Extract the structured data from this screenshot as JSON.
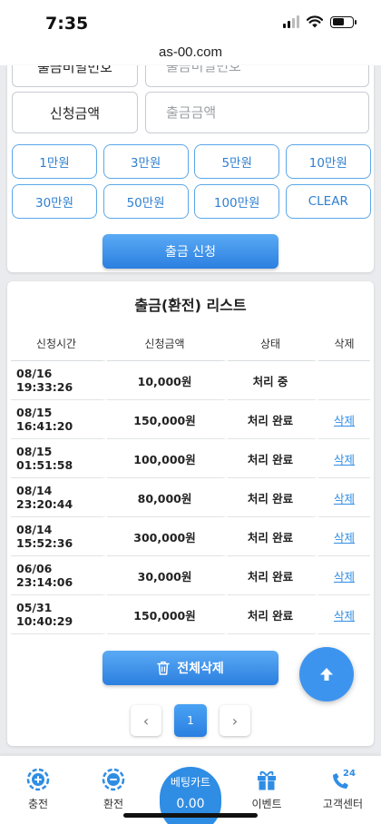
{
  "status": {
    "time": "7:35"
  },
  "url": "as-00.com",
  "form": {
    "password_row": {
      "label": "출금비밀번호",
      "placeholder": "출금비밀번호"
    },
    "amount_row": {
      "label": "신청금액",
      "placeholder": "출금금액"
    },
    "amount_buttons": [
      "1만원",
      "3만원",
      "5만원",
      "10만원",
      "30만원",
      "50만원",
      "100만원",
      "CLEAR"
    ],
    "submit_label": "출금 신청"
  },
  "list": {
    "title": "출금(환전) 리스트",
    "headers": [
      "신청시간",
      "신청금액",
      "상태",
      "삭제"
    ],
    "rows": [
      {
        "time": "08/16 19:33:26",
        "amount": "10,000원",
        "status": "처리 중",
        "delete": ""
      },
      {
        "time": "08/15 16:41:20",
        "amount": "150,000원",
        "status": "처리 완료",
        "delete": "삭제"
      },
      {
        "time": "08/15 01:51:58",
        "amount": "100,000원",
        "status": "처리 완료",
        "delete": "삭제"
      },
      {
        "time": "08/14 23:20:44",
        "amount": "80,000원",
        "status": "처리 완료",
        "delete": "삭제"
      },
      {
        "time": "08/14 15:52:36",
        "amount": "300,000원",
        "status": "처리 완료",
        "delete": "삭제"
      },
      {
        "time": "06/06 23:14:06",
        "amount": "30,000원",
        "status": "처리 완료",
        "delete": "삭제"
      },
      {
        "time": "05/31 10:40:29",
        "amount": "150,000원",
        "status": "처리 완료",
        "delete": "삭제"
      }
    ],
    "delete_all_label": "전체삭제",
    "pagination": {
      "prev": "‹",
      "current": "1",
      "next": "›"
    }
  },
  "nav": {
    "items": [
      {
        "label": "충전",
        "icon": "charge-icon"
      },
      {
        "label": "환전",
        "icon": "exchange-icon"
      },
      {
        "label": "이벤트",
        "icon": "gift-icon"
      },
      {
        "label": "고객센터",
        "icon": "phone-24-icon"
      }
    ],
    "cart": {
      "label": "베팅카트",
      "value": "0.00"
    }
  },
  "colors": {
    "accent": "#2f8de4",
    "button_border": "#5aa7ea"
  }
}
